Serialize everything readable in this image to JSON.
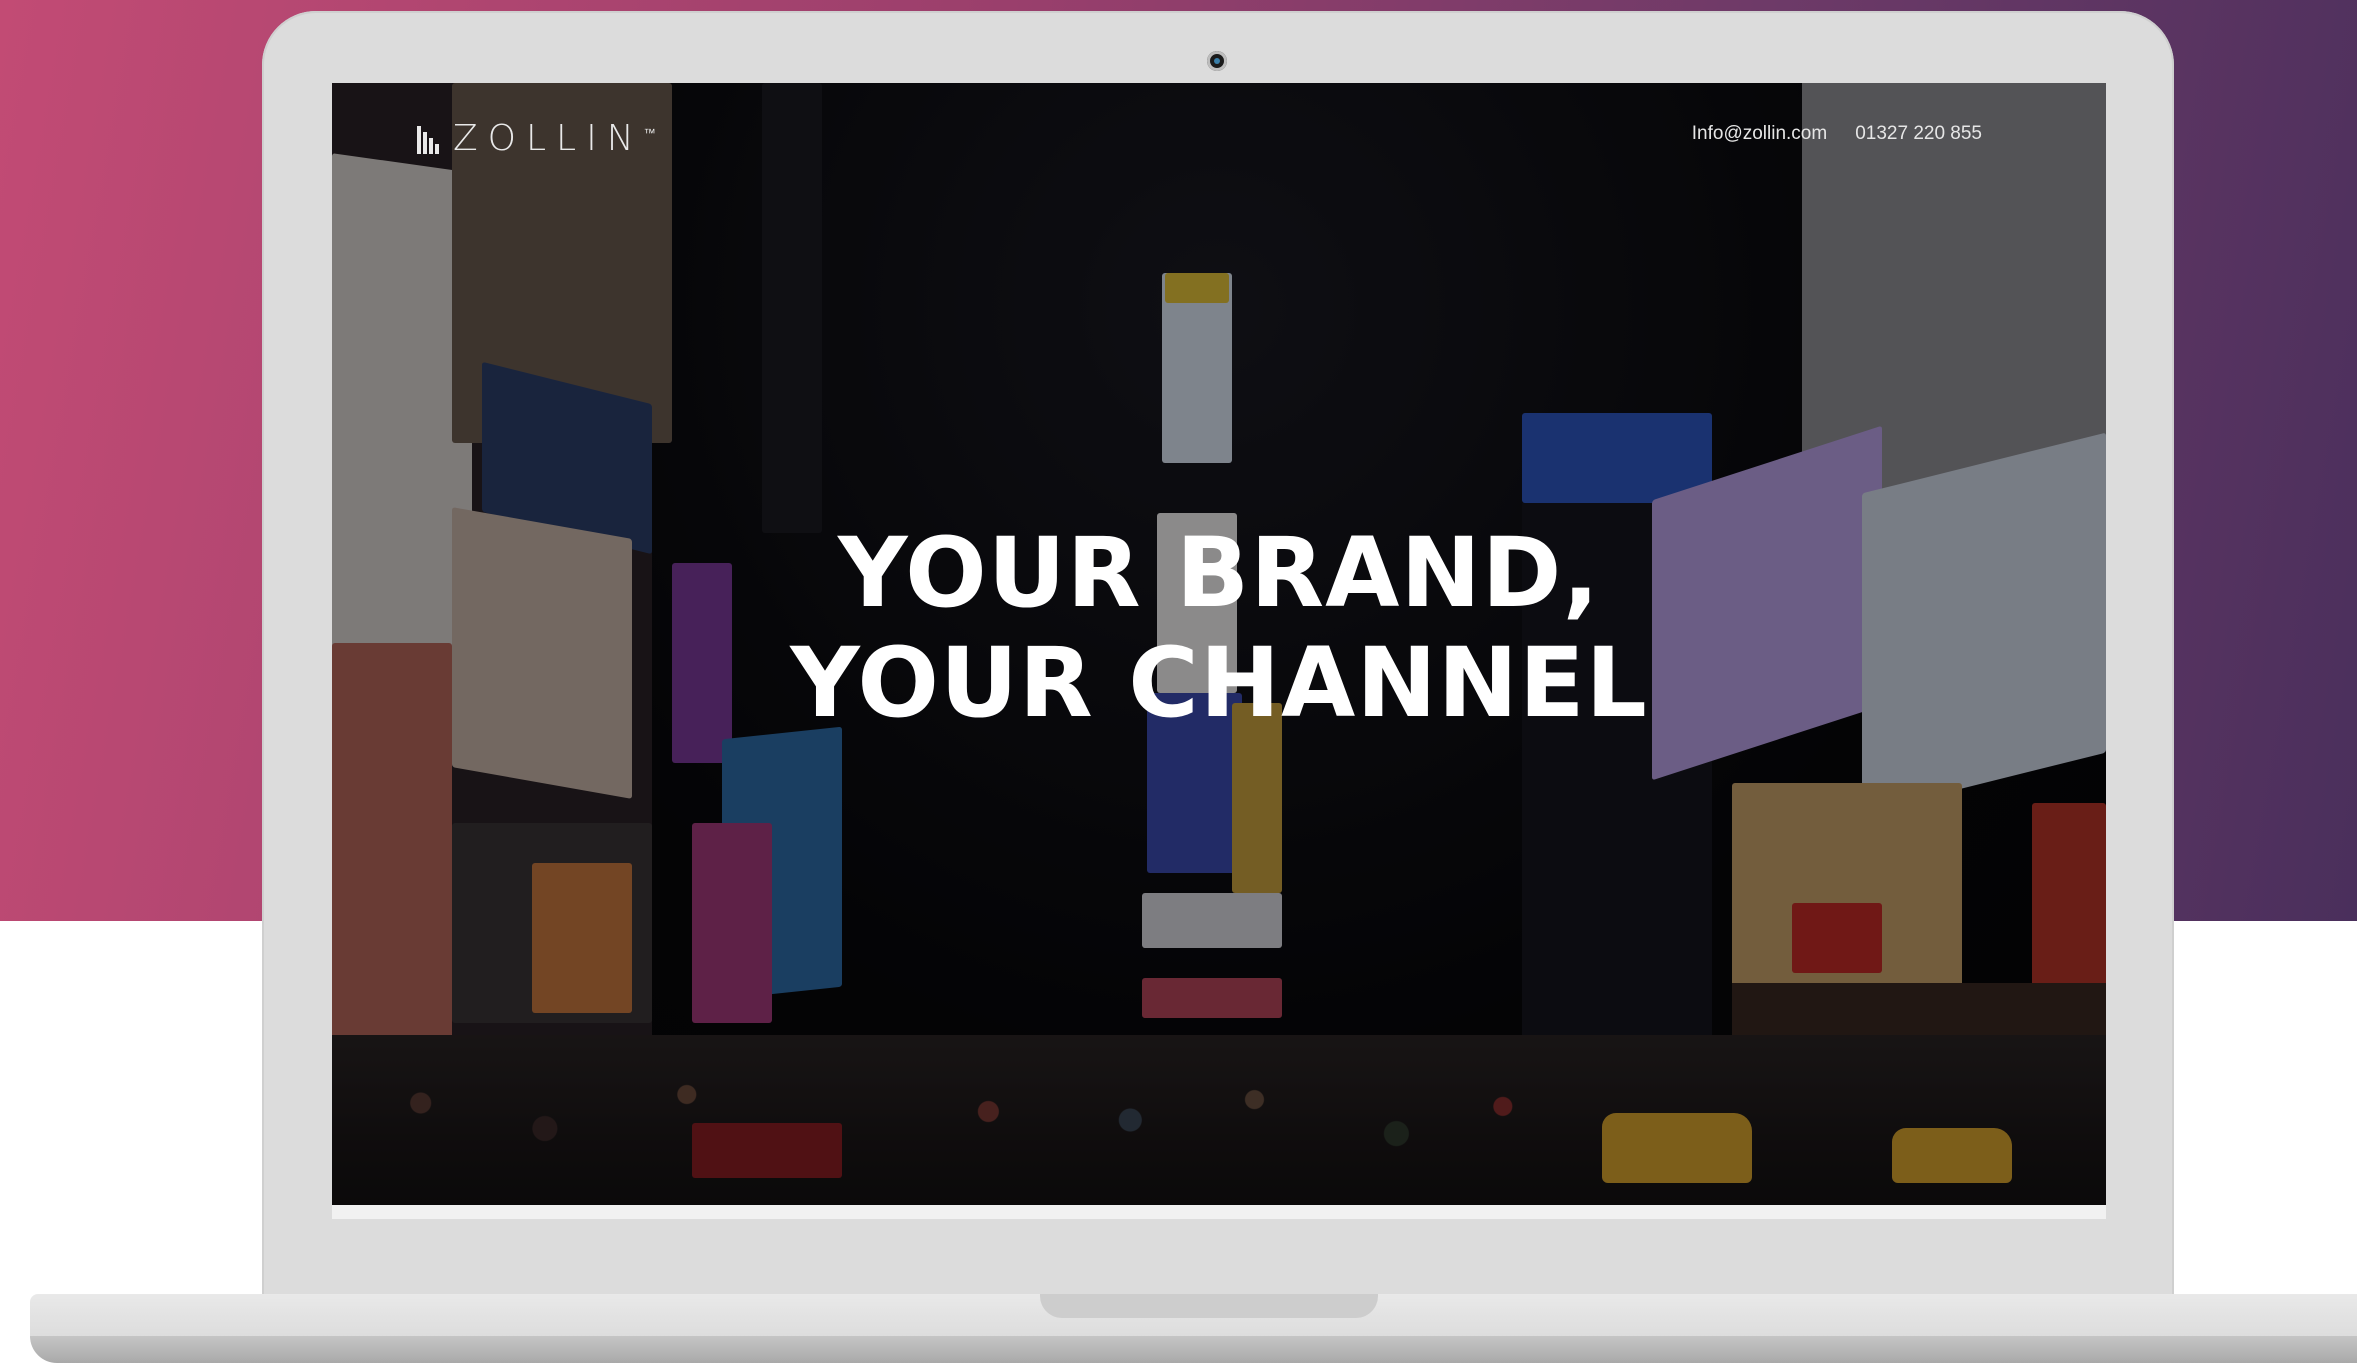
{
  "site": {
    "logo_text": "ZOLLIN",
    "logo_mark": "™",
    "email": "Info@zollin.com",
    "phone": "01327 220 855",
    "headline_line1": "YOUR BRAND,",
    "headline_line2": "YOUR CHANNEL"
  },
  "colors": {
    "background_gradient_start": "#c24b74",
    "background_gradient_end": "#4a2f5c",
    "laptop_frame": "#dcdcdc",
    "headline_text": "#ffffff"
  },
  "icons": {
    "logo_icon": "bars-logo-icon",
    "camera": "webcam-icon"
  }
}
